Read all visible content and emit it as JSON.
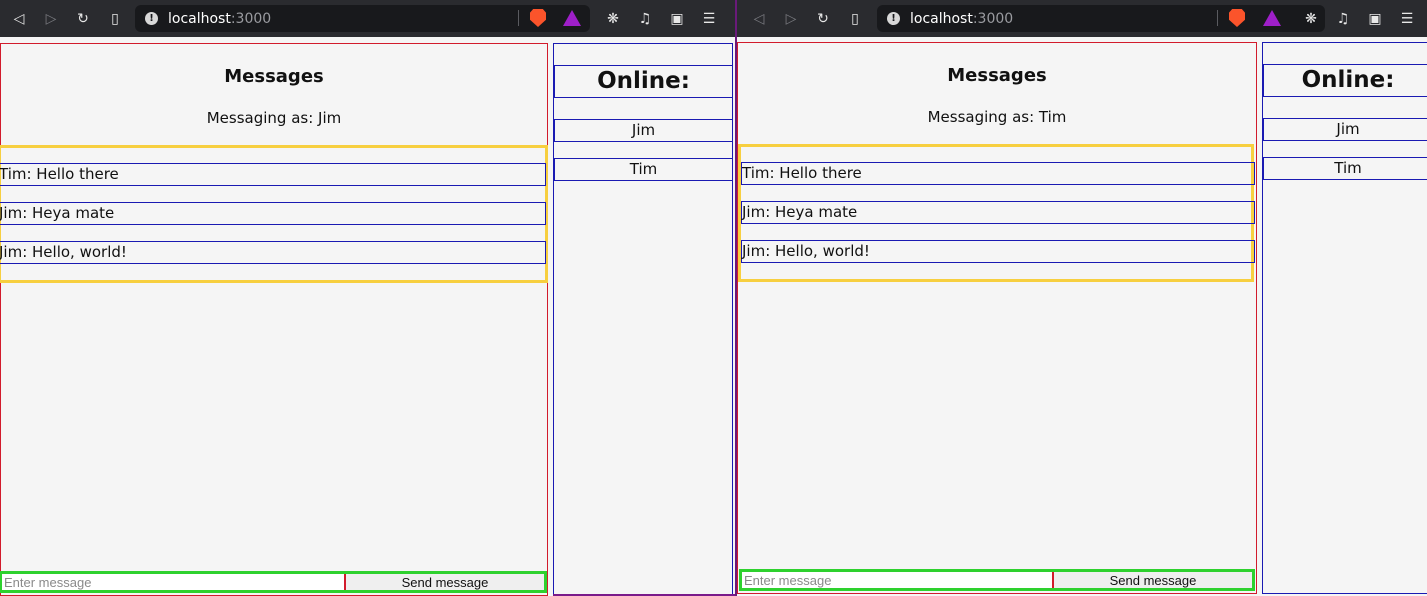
{
  "browser": {
    "host": "localhost",
    "port": ":3000"
  },
  "left": {
    "messages_title": "Messages",
    "messaging_as": "Messaging as: Jim",
    "messages": [
      "Tim: Hello there",
      "Jim: Heya mate",
      "Jim: Hello, world!"
    ],
    "input_placeholder": "Enter message",
    "send_label": "Send message",
    "online_title": "Online:",
    "online_users": [
      "Jim",
      "Tim"
    ]
  },
  "right": {
    "messages_title": "Messages",
    "messaging_as": "Messaging as: Tim",
    "messages": [
      "Tim: Hello there",
      "Jim: Heya mate",
      "Jim: Hello, world!"
    ],
    "input_placeholder": "Enter message",
    "send_label": "Send message",
    "online_title": "Online:",
    "online_users": [
      "Jim",
      "Tim"
    ]
  },
  "icons": [
    "back-icon",
    "forward-icon",
    "reload-icon",
    "bookmark-icon",
    "site-info-icon",
    "brave-shields-icon",
    "brave-rewards-icon",
    "extensions-icon",
    "media-queue-icon",
    "wallet-icon",
    "menu-icon"
  ],
  "colors": {
    "panel_border": "#d21b2c",
    "list_border": "#f7cf3f",
    "item_border": "#1a1ab2",
    "input_row_border": "#2ed12e",
    "page_bg": "#f5f5f5"
  }
}
